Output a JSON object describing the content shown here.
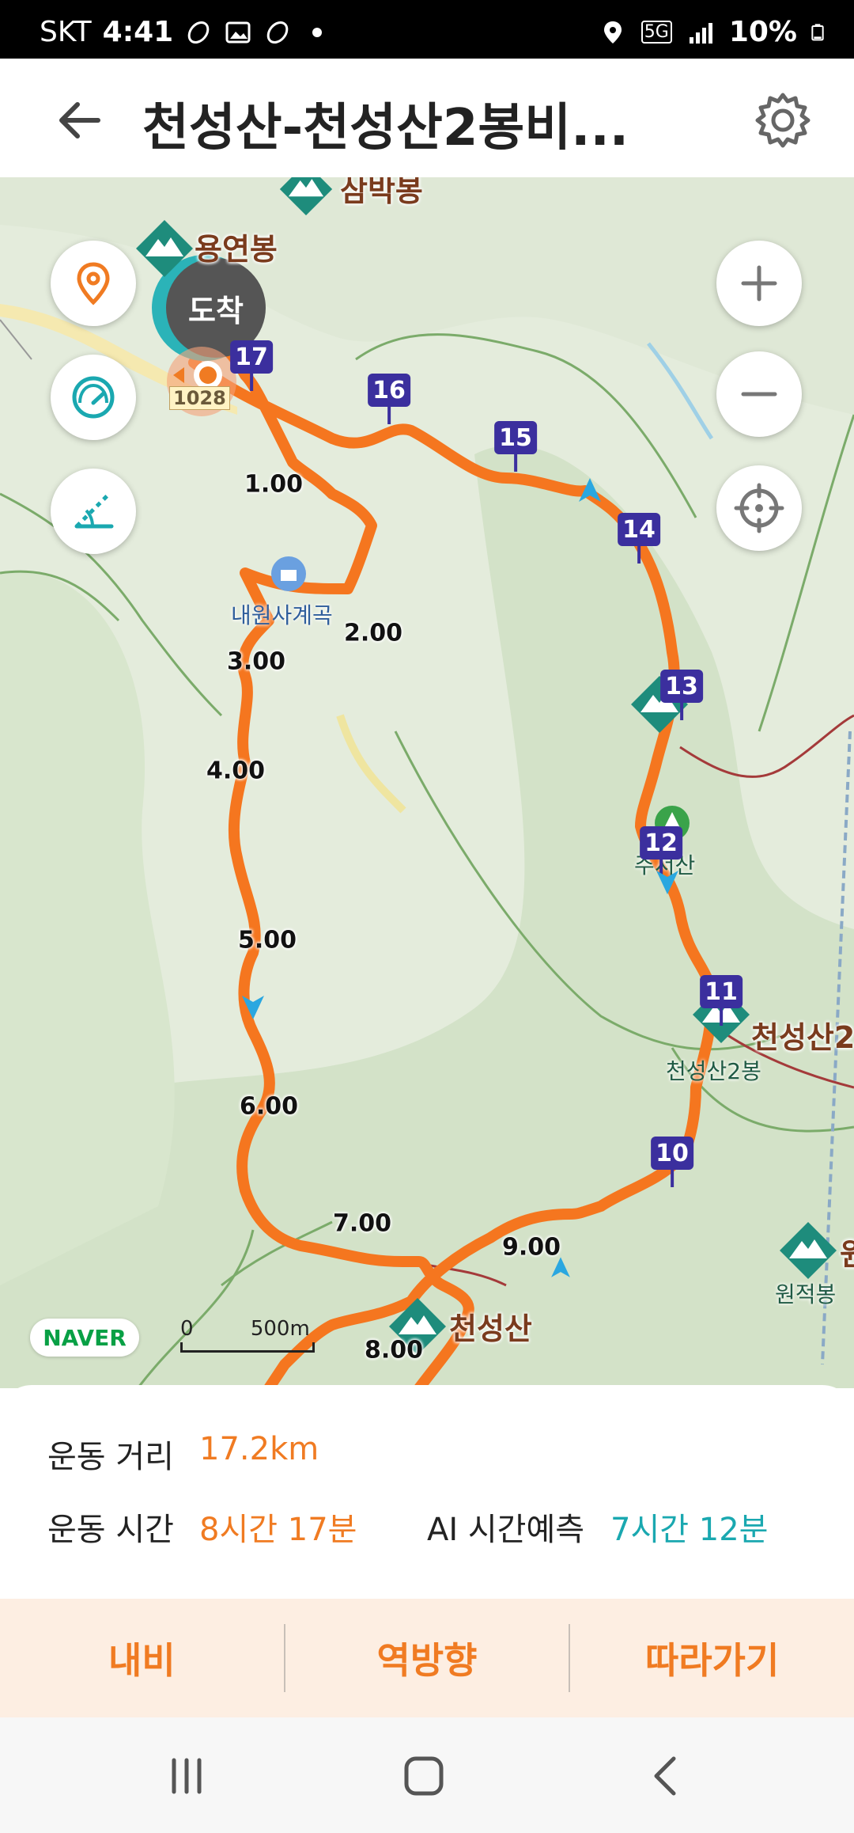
{
  "status_bar": {
    "carrier": "SKT",
    "time": "4:41",
    "network": "5G",
    "battery": "10%"
  },
  "header": {
    "title": "천성산-천성산2봉비..."
  },
  "map": {
    "arrive_badge": "도착",
    "road_number": "1028",
    "places": {
      "yongyeonbong": "용연봉",
      "top_partial": "삼박봉",
      "naewonsa": "내원사계곡",
      "juseongsan": "주서산",
      "cheonseongsan_right": "천성산2",
      "cheonseongsan2bong": "천성산2봉",
      "cheonseongsan": "천성산",
      "cheonseongsan_small": "천성산",
      "wonjeokbong": "원적봉",
      "right_edge": "원"
    },
    "waypoints": [
      "17",
      "16",
      "15",
      "14",
      "13",
      "12",
      "11",
      "10"
    ],
    "km_labels": [
      "1.00",
      "2.00",
      "3.00",
      "4.00",
      "5.00",
      "6.00",
      "7.00",
      "8.00",
      "9.00"
    ],
    "naver": "NAVER",
    "scale_zero": "0",
    "scale_value": "500m",
    "route_color": "#f5761f",
    "marker_color": "#3b2f9e"
  },
  "stats": {
    "distance_label": "운동 거리",
    "distance_value": "17.2km",
    "time_label": "운동 시간",
    "time_value": "8시간 17분",
    "ai_label": "AI 시간예측",
    "ai_value": "7시간 12분"
  },
  "actions": {
    "navi": "내비",
    "reverse": "역방향",
    "follow": "따라가기"
  }
}
